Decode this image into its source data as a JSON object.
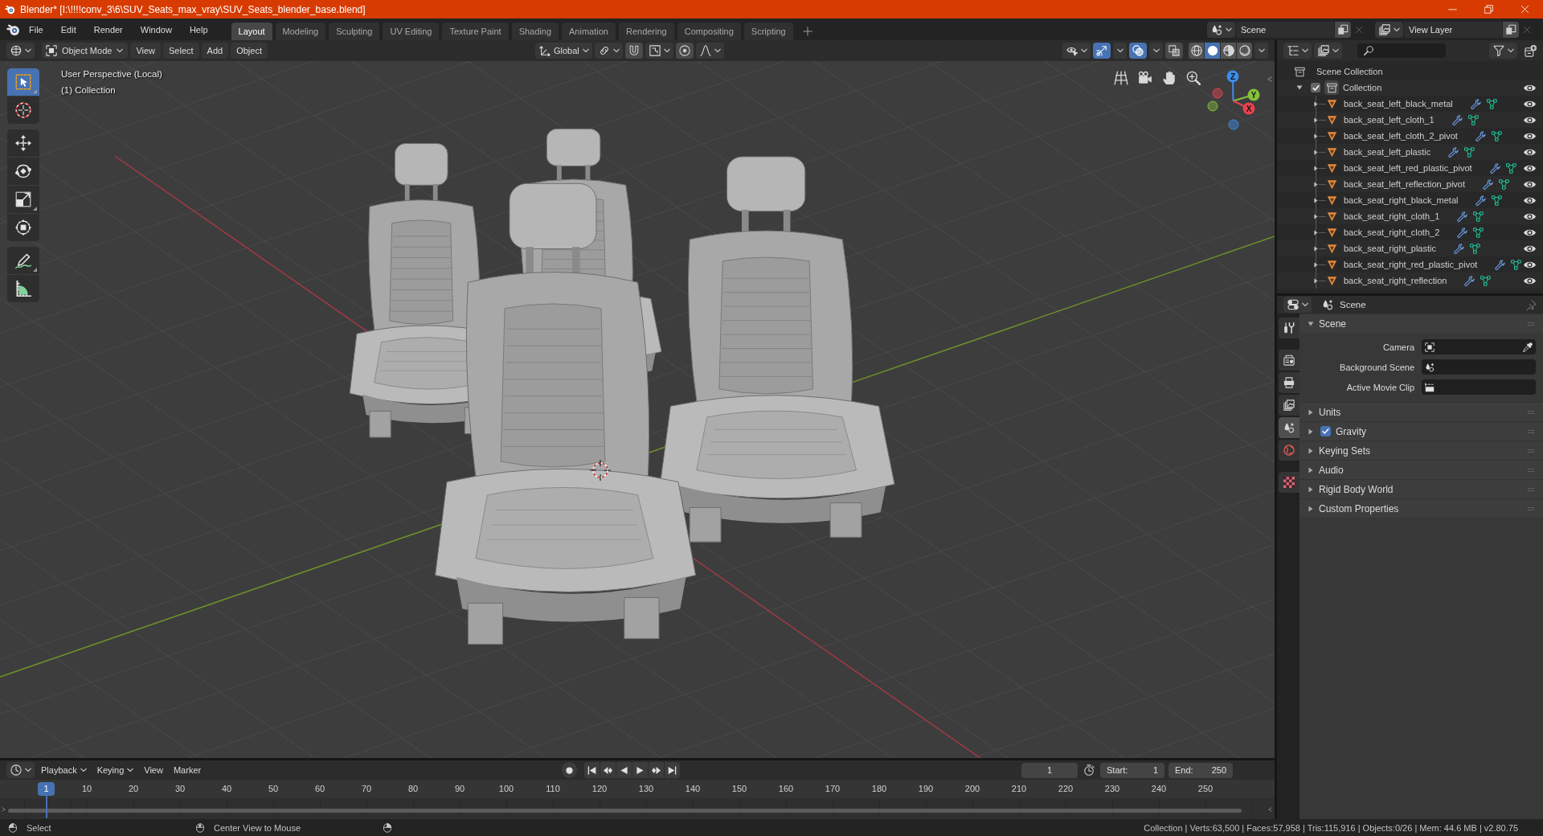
{
  "window": {
    "title": "Blender* [I:\\!!!!conv_3\\6\\SUV_Seats_max_vray\\SUV_Seats_blender_base.blend]"
  },
  "menu": [
    "File",
    "Edit",
    "Render",
    "Window",
    "Help"
  ],
  "workspaces": [
    {
      "label": "Layout",
      "selected": true
    },
    {
      "label": "Modeling",
      "selected": false
    },
    {
      "label": "Sculpting",
      "selected": false
    },
    {
      "label": "UV Editing",
      "selected": false
    },
    {
      "label": "Texture Paint",
      "selected": false
    },
    {
      "label": "Shading",
      "selected": false
    },
    {
      "label": "Animation",
      "selected": false
    },
    {
      "label": "Rendering",
      "selected": false
    },
    {
      "label": "Compositing",
      "selected": false
    },
    {
      "label": "Scripting",
      "selected": false
    }
  ],
  "scene": {
    "value": "Scene"
  },
  "view_layer": {
    "value": "View Layer"
  },
  "viewport_header": {
    "mode": "Object Mode",
    "menus": [
      "View",
      "Select",
      "Add",
      "Object"
    ],
    "orientation": "Global",
    "snap": false,
    "proportional_editing": false,
    "gizmos": true,
    "overlays": true,
    "xray": false,
    "shading": [
      {
        "kind": "wireframe",
        "selected": false
      },
      {
        "kind": "solid",
        "selected": true
      },
      {
        "kind": "material",
        "selected": false
      },
      {
        "kind": "rendered",
        "selected": false
      }
    ]
  },
  "viewport": {
    "overlay_text": [
      "User Perspective (Local)",
      "(1) Collection"
    ],
    "tool_groups": [
      [
        {
          "kind": "select_box",
          "selected": true,
          "has_variants": true
        },
        {
          "kind": "cursor",
          "selected": false,
          "has_variants": false
        }
      ],
      [
        {
          "kind": "move",
          "selected": false,
          "has_variants": false
        },
        {
          "kind": "rotate",
          "selected": false,
          "has_variants": false
        },
        {
          "kind": "scale",
          "selected": false,
          "has_variants": true
        },
        {
          "kind": "transform",
          "selected": false,
          "has_variants": false
        }
      ],
      [
        {
          "kind": "annotate",
          "selected": false,
          "has_variants": true
        },
        {
          "kind": "measure",
          "selected": false,
          "has_variants": false
        }
      ]
    ],
    "nav_axes": [
      {
        "label": "Z",
        "color": "#3b8ee8"
      },
      {
        "label": "Y",
        "color": "#86c13b"
      },
      {
        "label": "X",
        "color": "#e84250"
      }
    ]
  },
  "outliner": {
    "root": "Scene Collection",
    "collections": [
      {
        "name": "Collection",
        "expanded": true,
        "checked": true,
        "visible": true,
        "children": [
          {
            "name": "back_seat_left_black_metal",
            "expanded": false,
            "visible": true
          },
          {
            "name": "back_seat_left_cloth_1",
            "expanded": false,
            "visible": true
          },
          {
            "name": "back_seat_left_cloth_2_pivot",
            "expanded": false,
            "visible": true
          },
          {
            "name": "back_seat_left_plastic",
            "expanded": false,
            "visible": true
          },
          {
            "name": "back_seat_left_red_plastic_pivot",
            "expanded": false,
            "visible": true
          },
          {
            "name": "back_seat_left_reflection_pivot",
            "expanded": false,
            "visible": true
          },
          {
            "name": "back_seat_right_black_metal",
            "expanded": false,
            "visible": true
          },
          {
            "name": "back_seat_right_cloth_1",
            "expanded": false,
            "visible": true
          },
          {
            "name": "back_seat_right_cloth_2",
            "expanded": false,
            "visible": true
          },
          {
            "name": "back_seat_right_plastic",
            "expanded": false,
            "visible": true
          },
          {
            "name": "back_seat_right_red_plastic_pivot",
            "expanded": false,
            "visible": true
          },
          {
            "name": "back_seat_right_reflection",
            "expanded": false,
            "visible": true
          }
        ]
      }
    ]
  },
  "properties": {
    "context": "Scene",
    "tab_groups": [
      [
        {
          "kind": "tool",
          "selected": false
        }
      ],
      [
        {
          "kind": "render",
          "selected": false
        },
        {
          "kind": "output",
          "selected": false
        },
        {
          "kind": "view_layer",
          "selected": false
        },
        {
          "kind": "scene",
          "selected": true
        },
        {
          "kind": "world",
          "selected": false
        }
      ],
      [
        {
          "kind": "texture",
          "selected": false
        }
      ]
    ],
    "panels": [
      {
        "title": "Scene",
        "kind": "plain",
        "expanded": true,
        "fields": [
          {
            "label": "Camera",
            "kind": "object"
          },
          {
            "label": "Background Scene",
            "kind": "scene"
          },
          {
            "label": "Active Movie Clip",
            "kind": "clip"
          }
        ]
      },
      {
        "title": "Units",
        "kind": "plain",
        "expanded": false
      },
      {
        "title": "Gravity",
        "kind": "toggle",
        "checked": true,
        "expanded": false
      },
      {
        "title": "Keying Sets",
        "kind": "plain",
        "expanded": false
      },
      {
        "title": "Audio",
        "kind": "plain",
        "expanded": false
      },
      {
        "title": "Rigid Body World",
        "kind": "plain",
        "expanded": false
      },
      {
        "title": "Custom Properties",
        "kind": "plain",
        "expanded": false
      }
    ]
  },
  "timeline": {
    "menus": [
      {
        "label": "Playback",
        "dropdown": true
      },
      {
        "label": "Keying",
        "dropdown": true
      },
      {
        "label": "View",
        "dropdown": false
      },
      {
        "label": "Marker",
        "dropdown": false
      }
    ],
    "transport_groups": [
      [
        {
          "kind": "record"
        }
      ],
      [
        {
          "kind": "jump_start"
        },
        {
          "kind": "prev_key"
        },
        {
          "kind": "play_rev"
        },
        {
          "kind": "play"
        },
        {
          "kind": "next_key"
        },
        {
          "kind": "jump_end"
        }
      ]
    ],
    "current_frame": "1",
    "start": {
      "label": "Start:",
      "value": "1"
    },
    "end": {
      "label": "End:",
      "value": "250"
    },
    "playhead": "1",
    "ruler": [
      "10",
      "20",
      "30",
      "40",
      "50",
      "60",
      "70",
      "80",
      "90",
      "100",
      "110",
      "120",
      "130",
      "140",
      "150",
      "160",
      "170",
      "180",
      "190",
      "200",
      "210",
      "220",
      "230",
      "240",
      "250"
    ]
  },
  "status": {
    "items": [
      {
        "kind": "mouse_left",
        "label": "Select"
      },
      {
        "kind": "mouse_middle",
        "label": "Center View to Mouse"
      },
      {
        "kind": "mouse_right"
      }
    ],
    "info": "Collection | Verts:63,500 | Faces:57,958 | Tris:115,916 | Objects:0/26 | Mem: 44.6 MB | v2.80.75"
  }
}
